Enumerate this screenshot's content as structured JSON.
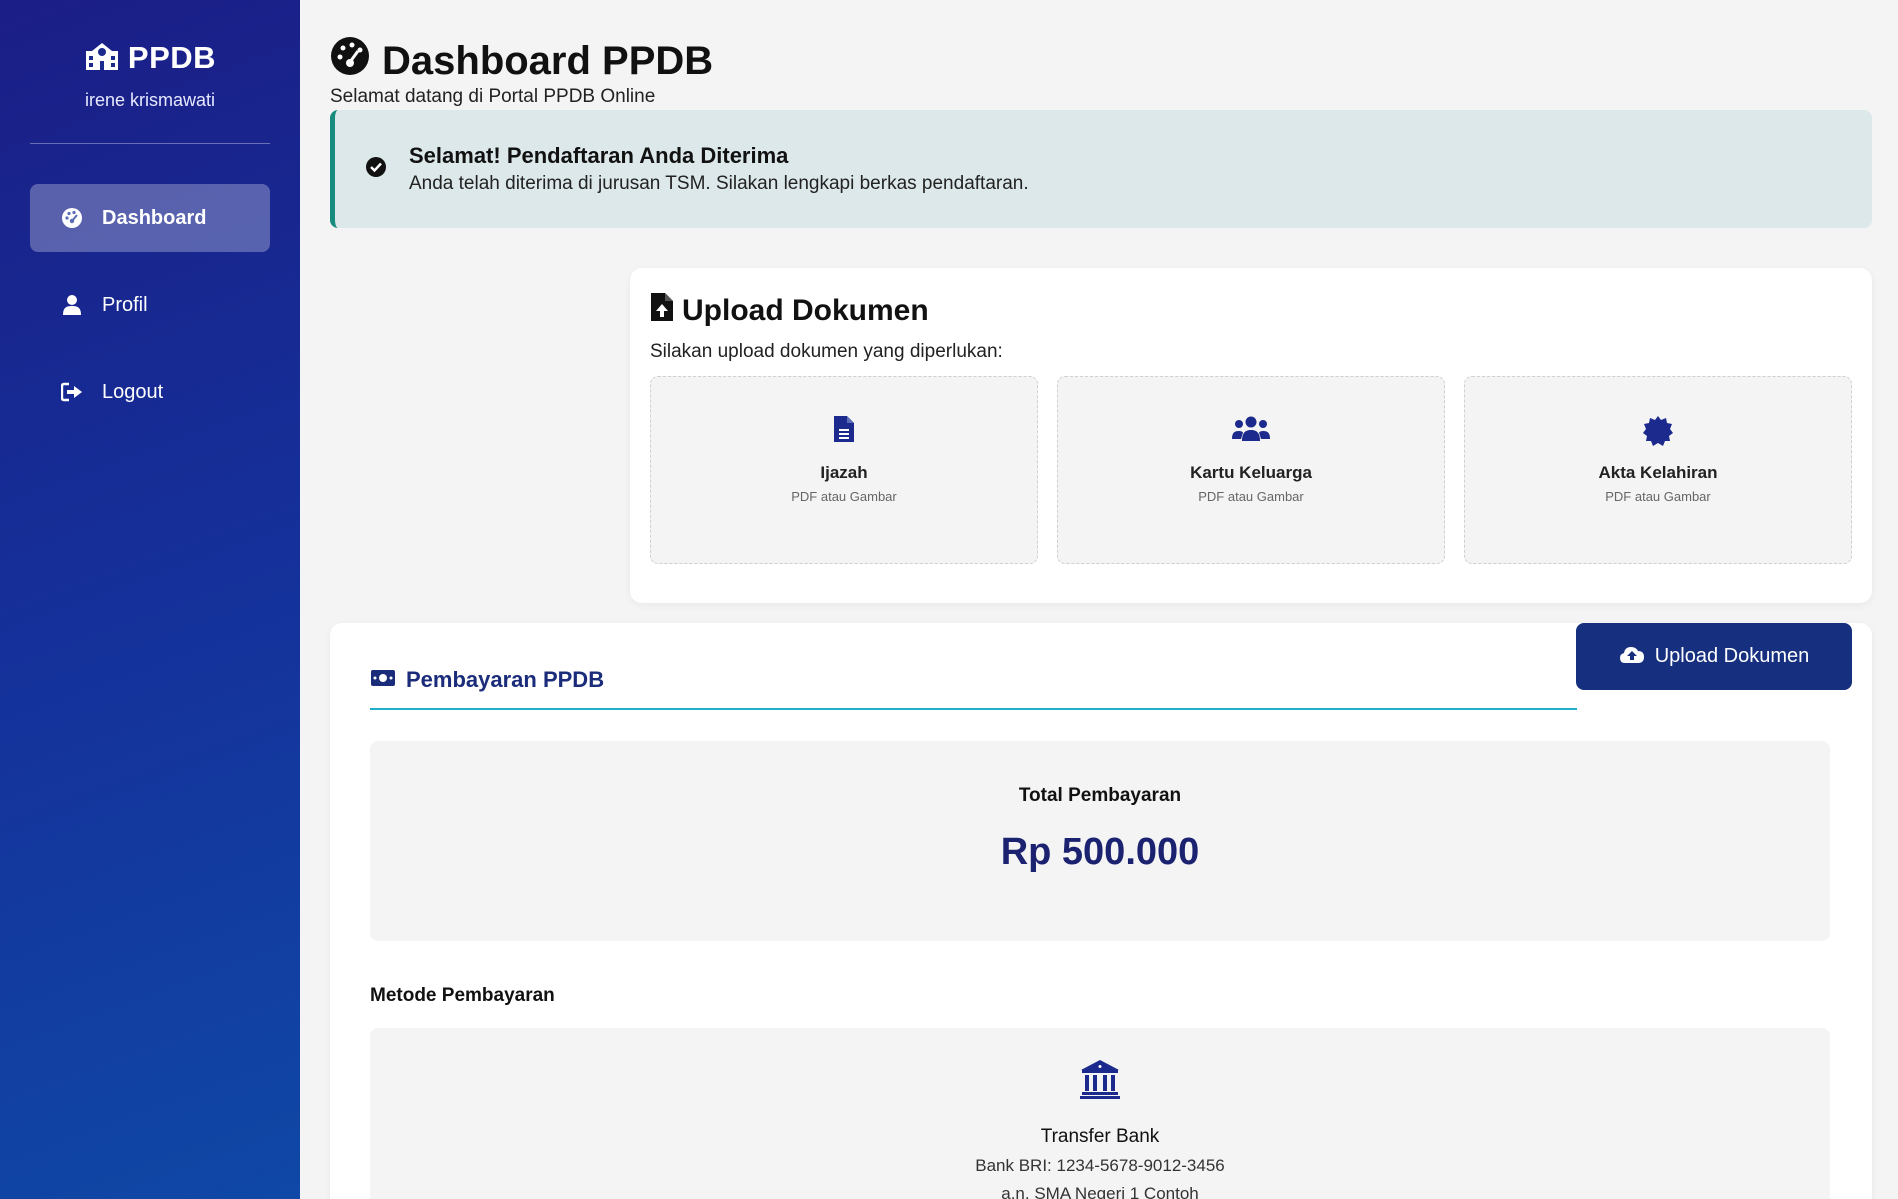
{
  "sidebar": {
    "brand": "PPDB",
    "user_name": "irene krismawati",
    "brand_icon": "school-icon",
    "items": [
      {
        "label": "Dashboard",
        "icon": "gauge-icon",
        "active": true
      },
      {
        "label": "Profil",
        "icon": "user-icon",
        "active": false
      },
      {
        "label": "Logout",
        "icon": "logout-icon",
        "active": false
      }
    ]
  },
  "header": {
    "title": "Dashboard PPDB",
    "subtitle": "Selamat datang di Portal PPDB Online"
  },
  "alert": {
    "title": "Selamat! Pendaftaran Anda Diterima",
    "message": "Anda telah diterima di jurusan TSM. Silakan lengkapi berkas pendaftaran.",
    "accent_color": "#178b7d"
  },
  "upload": {
    "title": "Upload Dokumen",
    "subtitle": "Silakan upload dokumen yang diperlukan:",
    "documents": [
      {
        "name": "Ijazah",
        "hint": "PDF atau Gambar",
        "icon": "file-icon"
      },
      {
        "name": "Kartu Keluarga",
        "hint": "PDF atau Gambar",
        "icon": "users-icon"
      },
      {
        "name": "Akta Kelahiran",
        "hint": "PDF atau Gambar",
        "icon": "certificate-icon"
      }
    ],
    "button_label": "Upload Dokumen"
  },
  "payment": {
    "title": "Pembayaran PPDB",
    "total_label": "Total Pembayaran",
    "total_value": "Rp 500.000",
    "method_title": "Metode Pembayaran",
    "method": {
      "name": "Transfer Bank",
      "account": "Bank BRI: 1234-5678-9012-3456",
      "holder": "a.n. SMA Negeri 1 Contoh"
    }
  },
  "colors": {
    "sidebar_start": "#1b1e86",
    "sidebar_end": "#0f48a6",
    "primary": "#16307f",
    "accent_line": "#1fb0c7"
  }
}
